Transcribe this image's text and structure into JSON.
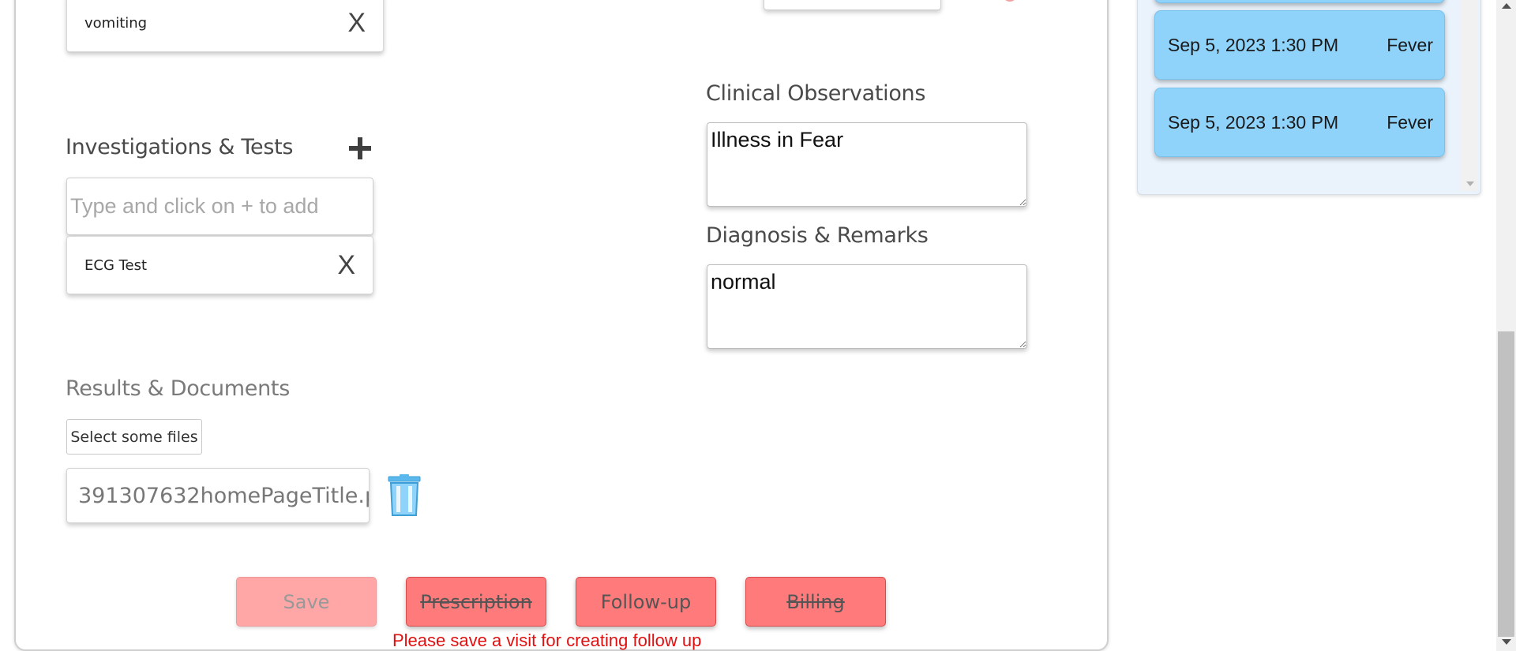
{
  "symptoms": {
    "items": [
      {
        "label": "vomiting",
        "remove_label": "X"
      }
    ]
  },
  "investigations": {
    "title": "Investigations & Tests",
    "input_placeholder": "Type and click on + to add",
    "input_value": "",
    "items": [
      {
        "label": "ECG Test",
        "remove_label": "X"
      }
    ]
  },
  "clinical_observations": {
    "title": "Clinical Observations",
    "value": "Illness in Fear"
  },
  "diagnosis": {
    "title": "Diagnosis & Remarks",
    "value": "normal"
  },
  "documents": {
    "title": "Results & Documents",
    "select_label": "Select some files",
    "files": [
      {
        "name": "391307632homePageTitle.p..."
      }
    ]
  },
  "actions": {
    "save_label": "Save",
    "prescription_label": "Prescription",
    "followup_label": "Follow-up",
    "billing_label": "Billing",
    "warning": "Please save a visit for creating follow up"
  },
  "visits": [
    {
      "datetime": "Sep 5, 2023 1:30 PM",
      "reason": "Fever"
    },
    {
      "datetime": "Sep 5, 2023 1:30 PM",
      "reason": "Fever"
    }
  ],
  "colors": {
    "button_red": "#ff7b7b",
    "visit_card": "#8fd3fb",
    "warning_red": "#e01010",
    "trash_blue": "#5bb8ec"
  }
}
